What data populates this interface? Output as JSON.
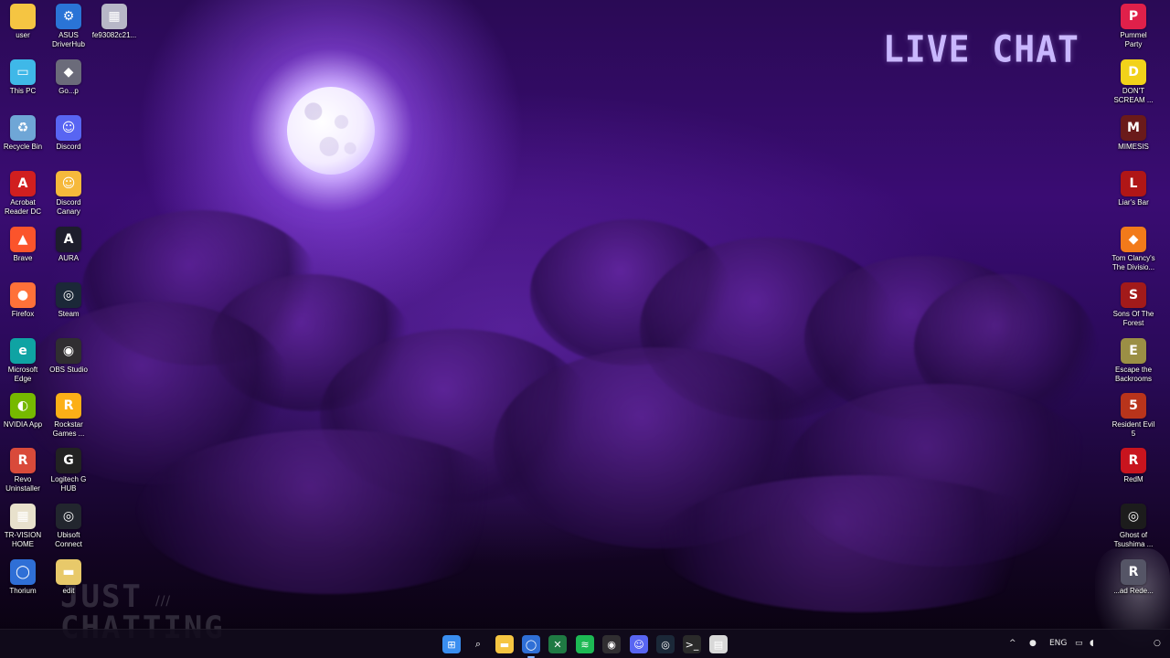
{
  "overlay": {
    "live_chat": "LIVE CHAT",
    "just": "JUST",
    "chatting": "CHATTING",
    "stripes": "///"
  },
  "desktop_left": [
    {
      "label": "user",
      "icon": "folder-icon",
      "color": "#f5c542",
      "glyph": ""
    },
    {
      "label": "ASUS DriverHub",
      "icon": "gear-icon",
      "color": "#2a74d6",
      "glyph": "⚙"
    },
    {
      "label": "fe93082c21...",
      "icon": "image-file-icon",
      "color": "#b7b7c7",
      "glyph": "▦"
    },
    {
      "label": "This PC",
      "icon": "monitor-icon",
      "color": "#3fb8e8",
      "glyph": "▭"
    },
    {
      "label": "Go...p",
      "icon": "app-icon",
      "color": "#6b6b7a",
      "glyph": "◆"
    },
    {
      "label": "Recycle Bin",
      "icon": "recycle-bin-icon",
      "color": "#6fa6d6",
      "glyph": "♻"
    },
    {
      "label": "Discord",
      "icon": "discord-icon",
      "color": "#5865f2",
      "glyph": "☺"
    },
    {
      "label": "Acrobat Reader DC",
      "icon": "acrobat-icon",
      "color": "#d11f1f",
      "glyph": "A"
    },
    {
      "label": "Discord Canary",
      "icon": "discord-canary-icon",
      "color": "#f6b93b",
      "glyph": "☺"
    },
    {
      "label": "Brave",
      "icon": "brave-icon",
      "color": "#fb542b",
      "glyph": "▲"
    },
    {
      "label": "AURA",
      "icon": "aura-icon",
      "color": "#1d1d2c",
      "glyph": "A"
    },
    {
      "label": "Firefox",
      "icon": "firefox-icon",
      "color": "#ff7139",
      "glyph": "●"
    },
    {
      "label": "Steam",
      "icon": "steam-icon",
      "color": "#1b2838",
      "glyph": "◎"
    },
    {
      "label": "Microsoft Edge",
      "icon": "edge-icon",
      "color": "#0fa3a3",
      "glyph": "e"
    },
    {
      "label": "OBS Studio",
      "icon": "obs-icon",
      "color": "#302e31",
      "glyph": "◉"
    },
    {
      "label": "NVIDIA App",
      "icon": "nvidia-icon",
      "color": "#76b900",
      "glyph": "◐"
    },
    {
      "label": "Rockstar Games ...",
      "icon": "rockstar-icon",
      "color": "#fcaf17",
      "glyph": "R"
    },
    {
      "label": "Revo Uninstaller",
      "icon": "revo-icon",
      "color": "#d94a3a",
      "glyph": "R"
    },
    {
      "label": "Logitech G HUB",
      "icon": "logitech-icon",
      "color": "#222222",
      "glyph": "G"
    },
    {
      "label": "TR-VISION HOME",
      "icon": "tr-vision-icon",
      "color": "#e8e1cc",
      "glyph": "▦"
    },
    {
      "label": "Ubisoft Connect",
      "icon": "ubisoft-icon",
      "color": "#22262e",
      "glyph": "◎"
    },
    {
      "label": "Thorium",
      "icon": "thorium-icon",
      "color": "#2f6fd6",
      "glyph": "◯"
    },
    {
      "label": "edit",
      "icon": "edit-file-icon",
      "color": "#e8c96a",
      "glyph": "▬"
    }
  ],
  "desktop_right": [
    {
      "label": "Pummel Party",
      "icon": "pummel-party-icon",
      "color": "#e0204a",
      "glyph": "P"
    },
    {
      "label": "DON'T SCREAM ...",
      "icon": "dont-scream-icon",
      "color": "#f2d21a",
      "glyph": "D"
    },
    {
      "label": "MIMESIS",
      "icon": "mimesis-icon",
      "color": "#6a1a1a",
      "glyph": "M"
    },
    {
      "label": "Liar's Bar",
      "icon": "liars-bar-icon",
      "color": "#b01616",
      "glyph": "L"
    },
    {
      "label": "Tom Clancy's The Divisio...",
      "icon": "division-icon",
      "color": "#f27a1a",
      "glyph": "◆"
    },
    {
      "label": "Sons Of The Forest",
      "icon": "sons-forest-icon",
      "color": "#a21a1a",
      "glyph": "S"
    },
    {
      "label": "Escape the Backrooms",
      "icon": "backrooms-icon",
      "color": "#9b8f45",
      "glyph": "E"
    },
    {
      "label": "Resident Evil 5",
      "icon": "resident-evil-icon",
      "color": "#b8341b",
      "glyph": "5"
    },
    {
      "label": "RedM",
      "icon": "redm-icon",
      "color": "#c8141e",
      "glyph": "R"
    },
    {
      "label": "Ghost of Tsushima ...",
      "icon": "ghost-tsushima-icon",
      "color": "#1c1c1c",
      "glyph": "◎"
    },
    {
      "label": "...ad Rede...",
      "icon": "red-dead-icon",
      "color": "#555566",
      "glyph": "R"
    }
  ],
  "taskbar": {
    "apps": [
      {
        "name": "start-button",
        "glyph": "⊞",
        "color": "#3a8ef0"
      },
      {
        "name": "search-icon",
        "glyph": "⌕",
        "color": "transparent"
      },
      {
        "name": "file-explorer-icon",
        "glyph": "▬",
        "color": "#f5c542"
      },
      {
        "name": "thorium-icon",
        "glyph": "◯",
        "color": "#2f6fd6"
      },
      {
        "name": "excel-icon",
        "glyph": "✕",
        "color": "#1f7a43"
      },
      {
        "name": "spotify-icon",
        "glyph": "≋",
        "color": "#1db954"
      },
      {
        "name": "obs-icon",
        "glyph": "◉",
        "color": "#302e31"
      },
      {
        "name": "discord-icon",
        "glyph": "☺",
        "color": "#5865f2"
      },
      {
        "name": "steam-icon",
        "glyph": "◎",
        "color": "#1b2838"
      },
      {
        "name": "terminal-icon",
        "glyph": ">_",
        "color": "#2a2a2a"
      },
      {
        "name": "notepad-icon",
        "glyph": "▤",
        "color": "#d8d8d8"
      }
    ],
    "language": "ENG",
    "chevron": "^"
  }
}
